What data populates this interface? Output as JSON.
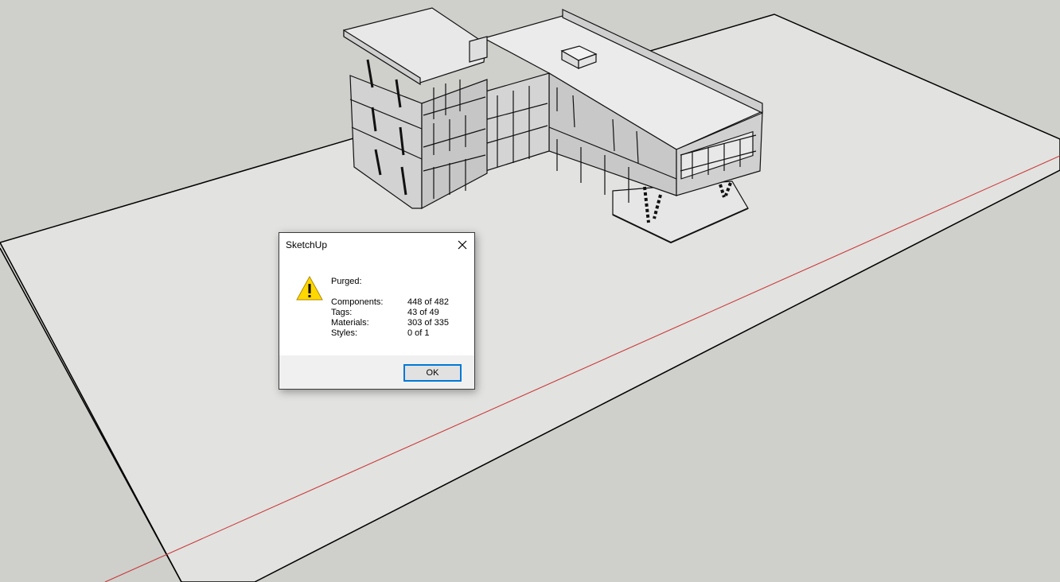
{
  "dialog": {
    "title": "SketchUp",
    "close_icon": "close-icon",
    "warning_icon": "warning-icon",
    "purged_label": "Purged:",
    "stats": [
      {
        "name": "Components:",
        "value": "448 of 482"
      },
      {
        "name": "Tags:",
        "value": "43 of 49"
      },
      {
        "name": "Materials:",
        "value": "303 of 335"
      },
      {
        "name": "Styles:",
        "value": "0 of 1"
      }
    ],
    "ok_label": "OK"
  },
  "colors": {
    "sky": "#cfcfcb",
    "ground": "#e2e2e0",
    "red_axis": "#c83030",
    "ok_border": "#0078d7",
    "warning_fill": "#ffd800"
  }
}
